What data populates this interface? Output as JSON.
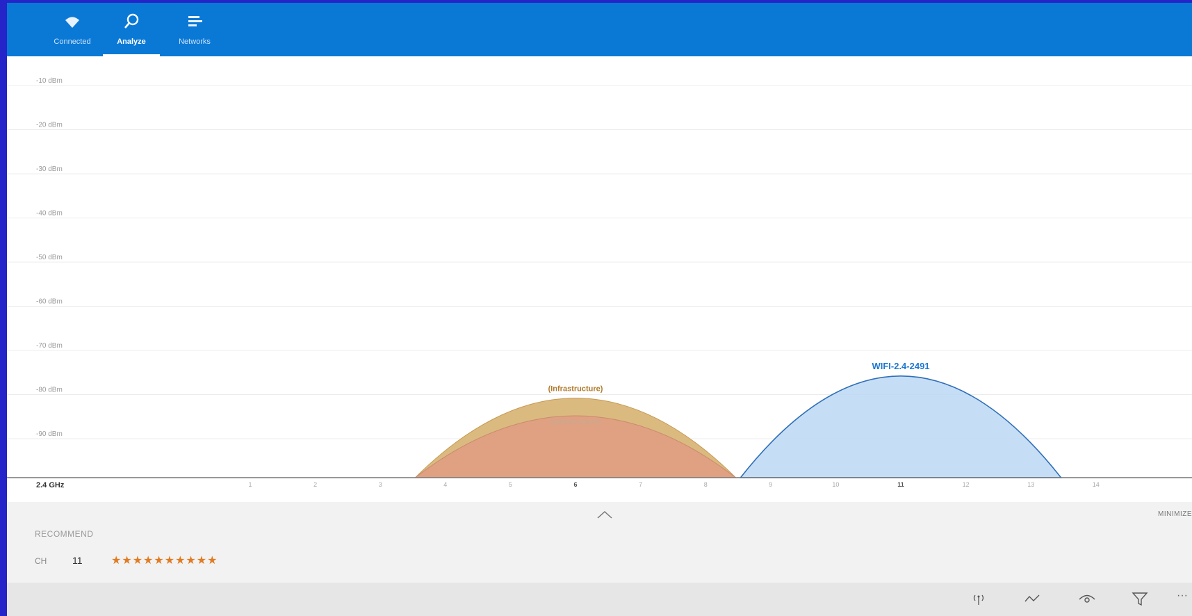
{
  "nav": {
    "tabs": [
      {
        "label": "Connected",
        "icon": "wifi-icon"
      },
      {
        "label": "Analyze",
        "icon": "search-icon"
      },
      {
        "label": "Networks",
        "icon": "list-icon"
      }
    ],
    "active": "Analyze"
  },
  "chart_data": {
    "type": "area",
    "band": "2.4 GHz",
    "y_axis": {
      "labels": [
        "-10 dBm",
        "-20 dBm",
        "-30 dBm",
        "-40 dBm",
        "-50 dBm",
        "-60 dBm",
        "-70 dBm",
        "-80 dBm",
        "-90 dBm"
      ],
      "ylim": [
        -100,
        -10
      ]
    },
    "x_axis": {
      "ticks": [
        "1",
        "2",
        "3",
        "4",
        "5",
        "6",
        "7",
        "8",
        "9",
        "10",
        "11",
        "12",
        "13",
        "14"
      ],
      "major_ticks": [
        "6",
        "11"
      ]
    },
    "networks": [
      {
        "name": "(Infrastructure)",
        "channel": 6,
        "signal_dbm": -82,
        "width_channels": 4.5,
        "color": "#d9b679",
        "stroke": "#c79a52",
        "label_color": "#b07a2c"
      },
      {
        "name": "(Infrastructure)",
        "channel": 6,
        "signal_dbm": -86,
        "width_channels": 4.5,
        "color": "#df9f82",
        "stroke": "#c98a6c",
        "label_color": "#c9a98f"
      },
      {
        "name": "WIFI-2.4-2491",
        "channel": 11,
        "signal_dbm": -77,
        "width_channels": 4.5,
        "color": "#bcd8f3",
        "stroke": "#2f6fb8",
        "label_color": "#1f78d1"
      }
    ]
  },
  "recommend": {
    "title": "RECOMMEND",
    "ch_label": "CH",
    "ch_value": "11",
    "stars": "★★★★★★★★★★",
    "minimize_label": "MINIMIZE"
  },
  "cmdbar": {
    "icons": [
      "signal-icon",
      "trend-icon",
      "eye-icon",
      "filter-icon",
      "more-icon"
    ],
    "more_glyph": "···"
  },
  "colors": {
    "accent": "#0a79d6",
    "frame": "#2424c8"
  }
}
